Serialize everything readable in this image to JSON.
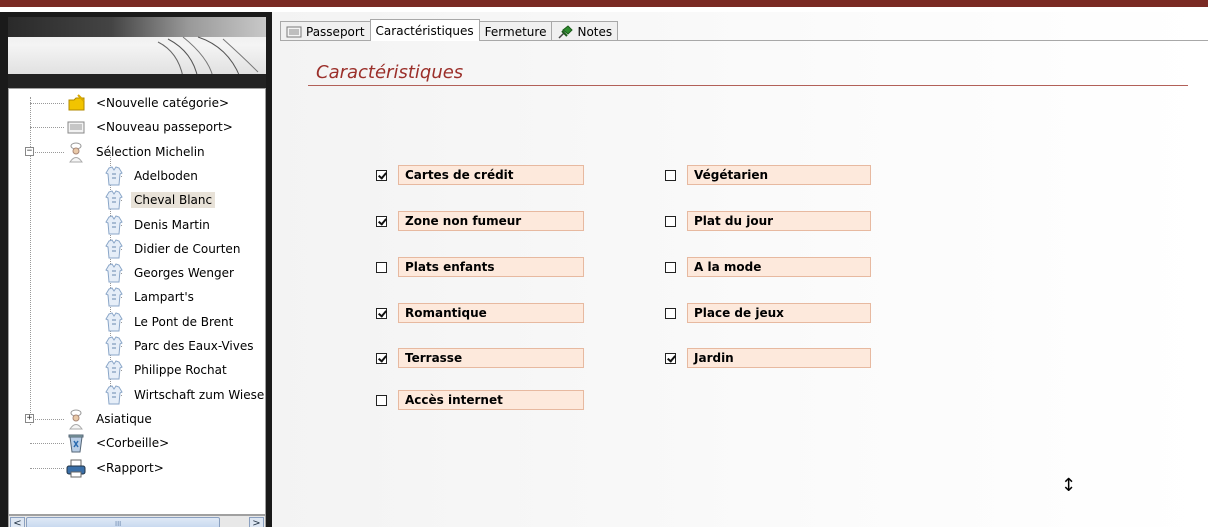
{
  "tree": {
    "items": [
      {
        "label": "<Nouvelle catégorie>",
        "icon": "folder-new-icon"
      },
      {
        "label": "<Nouveau passeport>",
        "icon": "document-icon"
      },
      {
        "label": "Sélection Michelin",
        "icon": "chef-icon",
        "expander": "−"
      },
      {
        "label": "Adelboden",
        "icon": "chef-jacket-icon"
      },
      {
        "label": "Cheval Blanc",
        "icon": "chef-jacket-icon",
        "selected": true
      },
      {
        "label": "Denis Martin",
        "icon": "chef-jacket-icon"
      },
      {
        "label": "Didier de Courten",
        "icon": "chef-jacket-icon"
      },
      {
        "label": "Georges Wenger",
        "icon": "chef-jacket-icon"
      },
      {
        "label": "Lampart's",
        "icon": "chef-jacket-icon"
      },
      {
        "label": "Le Pont de Brent",
        "icon": "chef-jacket-icon"
      },
      {
        "label": "Parc des Eaux-Vives",
        "icon": "chef-jacket-icon"
      },
      {
        "label": "Philippe Rochat",
        "icon": "chef-jacket-icon"
      },
      {
        "label": "Wirtschaft zum Wiese",
        "icon": "chef-jacket-icon"
      },
      {
        "label": "Asiatique",
        "icon": "chef-icon",
        "expander": "+"
      },
      {
        "label": "<Corbeille>",
        "icon": "recycle-bin-icon"
      },
      {
        "label": "<Rapport>",
        "icon": "printer-icon"
      }
    ]
  },
  "tabs": [
    {
      "label": "Passeport",
      "icon": "passport-icon",
      "active": false
    },
    {
      "label": "Caractéristiques",
      "icon": "",
      "active": true
    },
    {
      "label": "Fermeture",
      "icon": "",
      "active": false
    },
    {
      "label": "Notes",
      "icon": "pin-icon",
      "active": false
    }
  ],
  "section_title": "Caractéristiques",
  "features": [
    {
      "label": "Cartes de crédit",
      "checked": true
    },
    {
      "label": "Zone non fumeur",
      "checked": true
    },
    {
      "label": "Plats enfants",
      "checked": false
    },
    {
      "label": "Romantique",
      "checked": true
    },
    {
      "label": "Terrasse",
      "checked": true
    },
    {
      "label": "Accès internet",
      "checked": false
    },
    {
      "label": "Végétarien",
      "checked": false
    },
    {
      "label": "Plat du jour",
      "checked": false
    },
    {
      "label": "A la mode",
      "checked": false
    },
    {
      "label": "Place de jeux",
      "checked": false
    },
    {
      "label": "Jardin",
      "checked": true
    }
  ],
  "scrollbar": {
    "left_arrow": "<",
    "right_arrow": ">",
    "grip": "III"
  },
  "cursor_glyph": "↕",
  "colors": {
    "accent": "#9b2f2a",
    "field_bg": "#fde9dc",
    "field_border": "#e7b9a0"
  }
}
